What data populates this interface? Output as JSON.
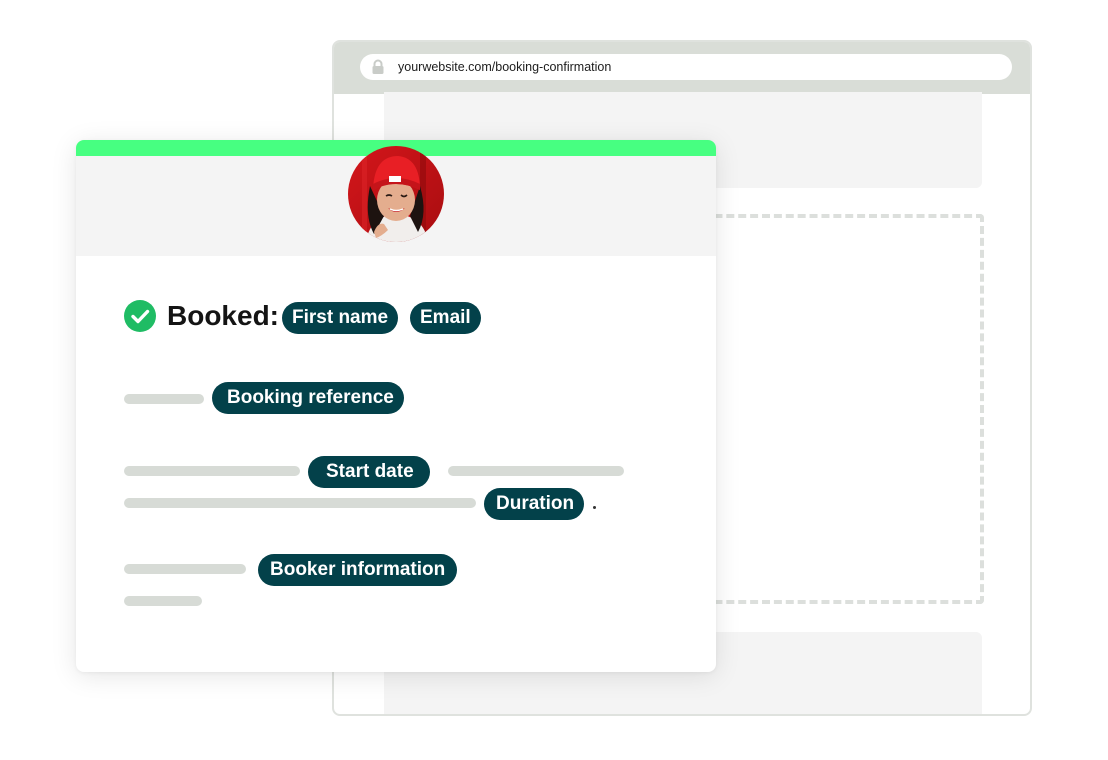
{
  "browser": {
    "url": "yourwebsite.com/booking-confirmation",
    "lock_icon": "lock-icon"
  },
  "confirmation": {
    "booked_label": "Booked:",
    "check_icon": "check-circle-icon",
    "avatar": "avatar-photo",
    "tags": {
      "first_name": "First name",
      "email": "Email",
      "booking_reference": "Booking reference",
      "start_date": "Start date",
      "duration": "Duration",
      "booker_information": "Booker information"
    }
  },
  "colors": {
    "accent": "#47ff81",
    "tag_background": "#03414a",
    "tag_text": "#ffffff",
    "check": "#1fbc64",
    "placeholder_line": "#d7dbd6"
  }
}
